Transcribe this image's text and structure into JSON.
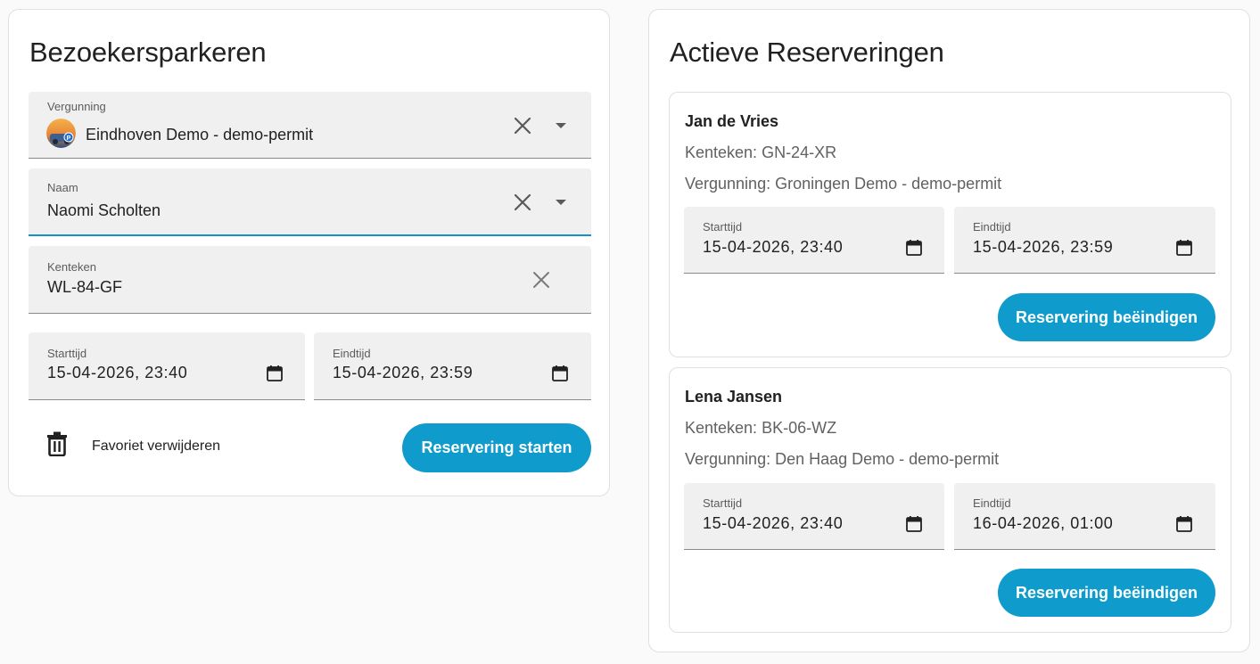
{
  "left_card": {
    "title": "Bezoekersparkeren",
    "permit_field": {
      "label": "Vergunning",
      "value": "Eindhoven Demo - demo-permit"
    },
    "name_field": {
      "label": "Naam",
      "value": "Naomi Scholten"
    },
    "plate_field": {
      "label": "Kenteken",
      "value": "WL-84-GF"
    },
    "start_field": {
      "label": "Starttijd",
      "value": "15-04-2026, 23:40"
    },
    "end_field": {
      "label": "Eindtijd",
      "value": "15-04-2026, 23:59"
    },
    "delete_favorite_label": "Favoriet verwijderen",
    "start_button_label": "Reservering starten"
  },
  "right_card": {
    "title": "Actieve Reserveringen",
    "reservations": [
      {
        "name": "Jan de Vries",
        "plate": "Kenteken: GN-24-XR",
        "permit": "Vergunning: Groningen Demo - demo-permit",
        "start_label": "Starttijd",
        "start_value": "15-04-2026, 23:40",
        "end_label": "Eindtijd",
        "end_value": "15-04-2026, 23:59",
        "end_button_label": "Reservering beëindigen"
      },
      {
        "name": "Lena Jansen",
        "plate": "Kenteken: BK-06-WZ",
        "permit": "Vergunning: Den Haag Demo - demo-permit",
        "start_label": "Starttijd",
        "start_value": "15-04-2026, 23:40",
        "end_label": "Eindtijd",
        "end_value": "16-04-2026, 01:00",
        "end_button_label": "Reservering beëindigen"
      }
    ]
  },
  "icons": {
    "clear": "close-icon",
    "dropdown": "arrow-drop-down-icon",
    "calendar": "calendar-icon",
    "delete": "trash-icon",
    "avatar": "parking-avatar"
  },
  "colors": {
    "accent": "#0f9bcb",
    "focus_underline": "#0f93c8",
    "field_bg": "#f0f0f0",
    "page_bg": "#fafafa"
  }
}
